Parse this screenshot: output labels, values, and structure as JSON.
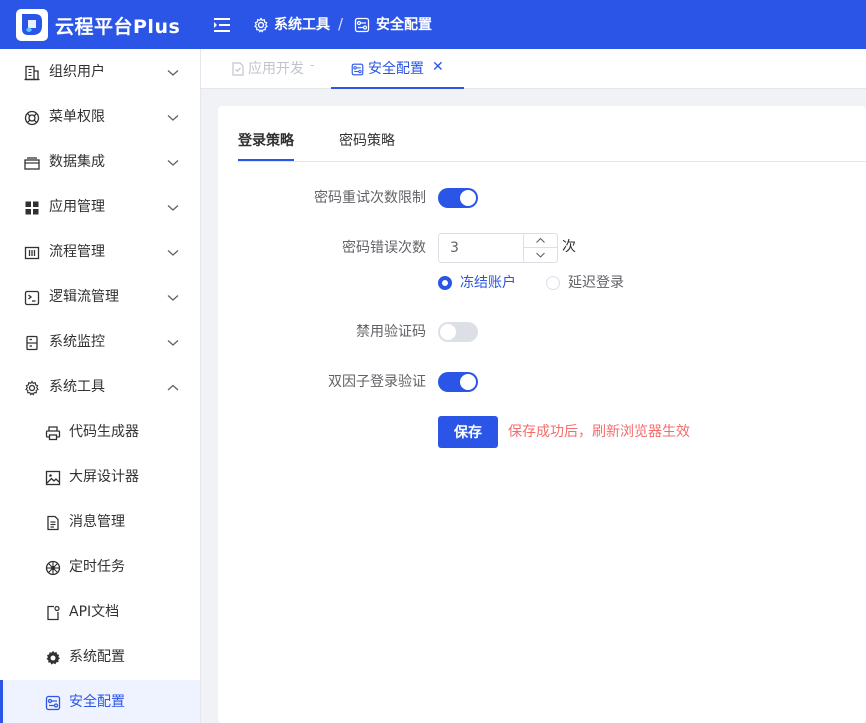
{
  "header": {
    "app_title": "云程平台Plus",
    "breadcrumb": [
      "系统工具",
      "安全配置"
    ],
    "breadcrumb_separator": "/",
    "brand_color": "#2b55e6"
  },
  "sidebar": {
    "items": [
      {
        "label": "组织用户",
        "icon": "building-icon"
      },
      {
        "label": "菜单权限",
        "icon": "lifebuoy-icon"
      },
      {
        "label": "数据集成",
        "icon": "tray-icon"
      },
      {
        "label": "应用管理",
        "icon": "grid-icon"
      },
      {
        "label": "流程管理",
        "icon": "columns-icon"
      },
      {
        "label": "逻辑流管理",
        "icon": "flow-icon"
      },
      {
        "label": "系统监控",
        "icon": "server-icon"
      },
      {
        "label": "系统工具",
        "icon": "gear-icon",
        "expanded": true
      }
    ],
    "sub_items": [
      {
        "label": "代码生成器",
        "icon": "printer-icon"
      },
      {
        "label": "大屏设计器",
        "icon": "image-icon"
      },
      {
        "label": "消息管理",
        "icon": "document-icon"
      },
      {
        "label": "定时任务",
        "icon": "clock-wheel-icon"
      },
      {
        "label": "API文档",
        "icon": "api-doc-icon"
      },
      {
        "label": "系统配置",
        "icon": "cog-icon"
      },
      {
        "label": "安全配置",
        "icon": "security-config-icon",
        "active": true
      }
    ]
  },
  "tabs": [
    {
      "label": "应用开发",
      "suffix": "-",
      "active": false
    },
    {
      "label": "安全配置",
      "close": "✕",
      "active": true
    }
  ],
  "content": {
    "tabs": [
      {
        "label": "登录策略",
        "active": true
      },
      {
        "label": "密码策略",
        "active": false
      }
    ],
    "form": {
      "retry_limit_label": "密码重试次数限制",
      "retry_limit_on": true,
      "error_count_label": "密码错误次数",
      "error_count_value": "3",
      "error_count_unit": "次",
      "action_options": [
        {
          "label": "冻结账户",
          "checked": true
        },
        {
          "label": "延迟登录",
          "checked": false
        }
      ],
      "disable_captcha_label": "禁用验证码",
      "disable_captcha_on": false,
      "two_factor_label": "双因子登录验证",
      "two_factor_on": true
    },
    "save_label": "保存",
    "save_hint": "保存成功后，刷新浏览器生效",
    "hint_color": "#f56c6c"
  }
}
